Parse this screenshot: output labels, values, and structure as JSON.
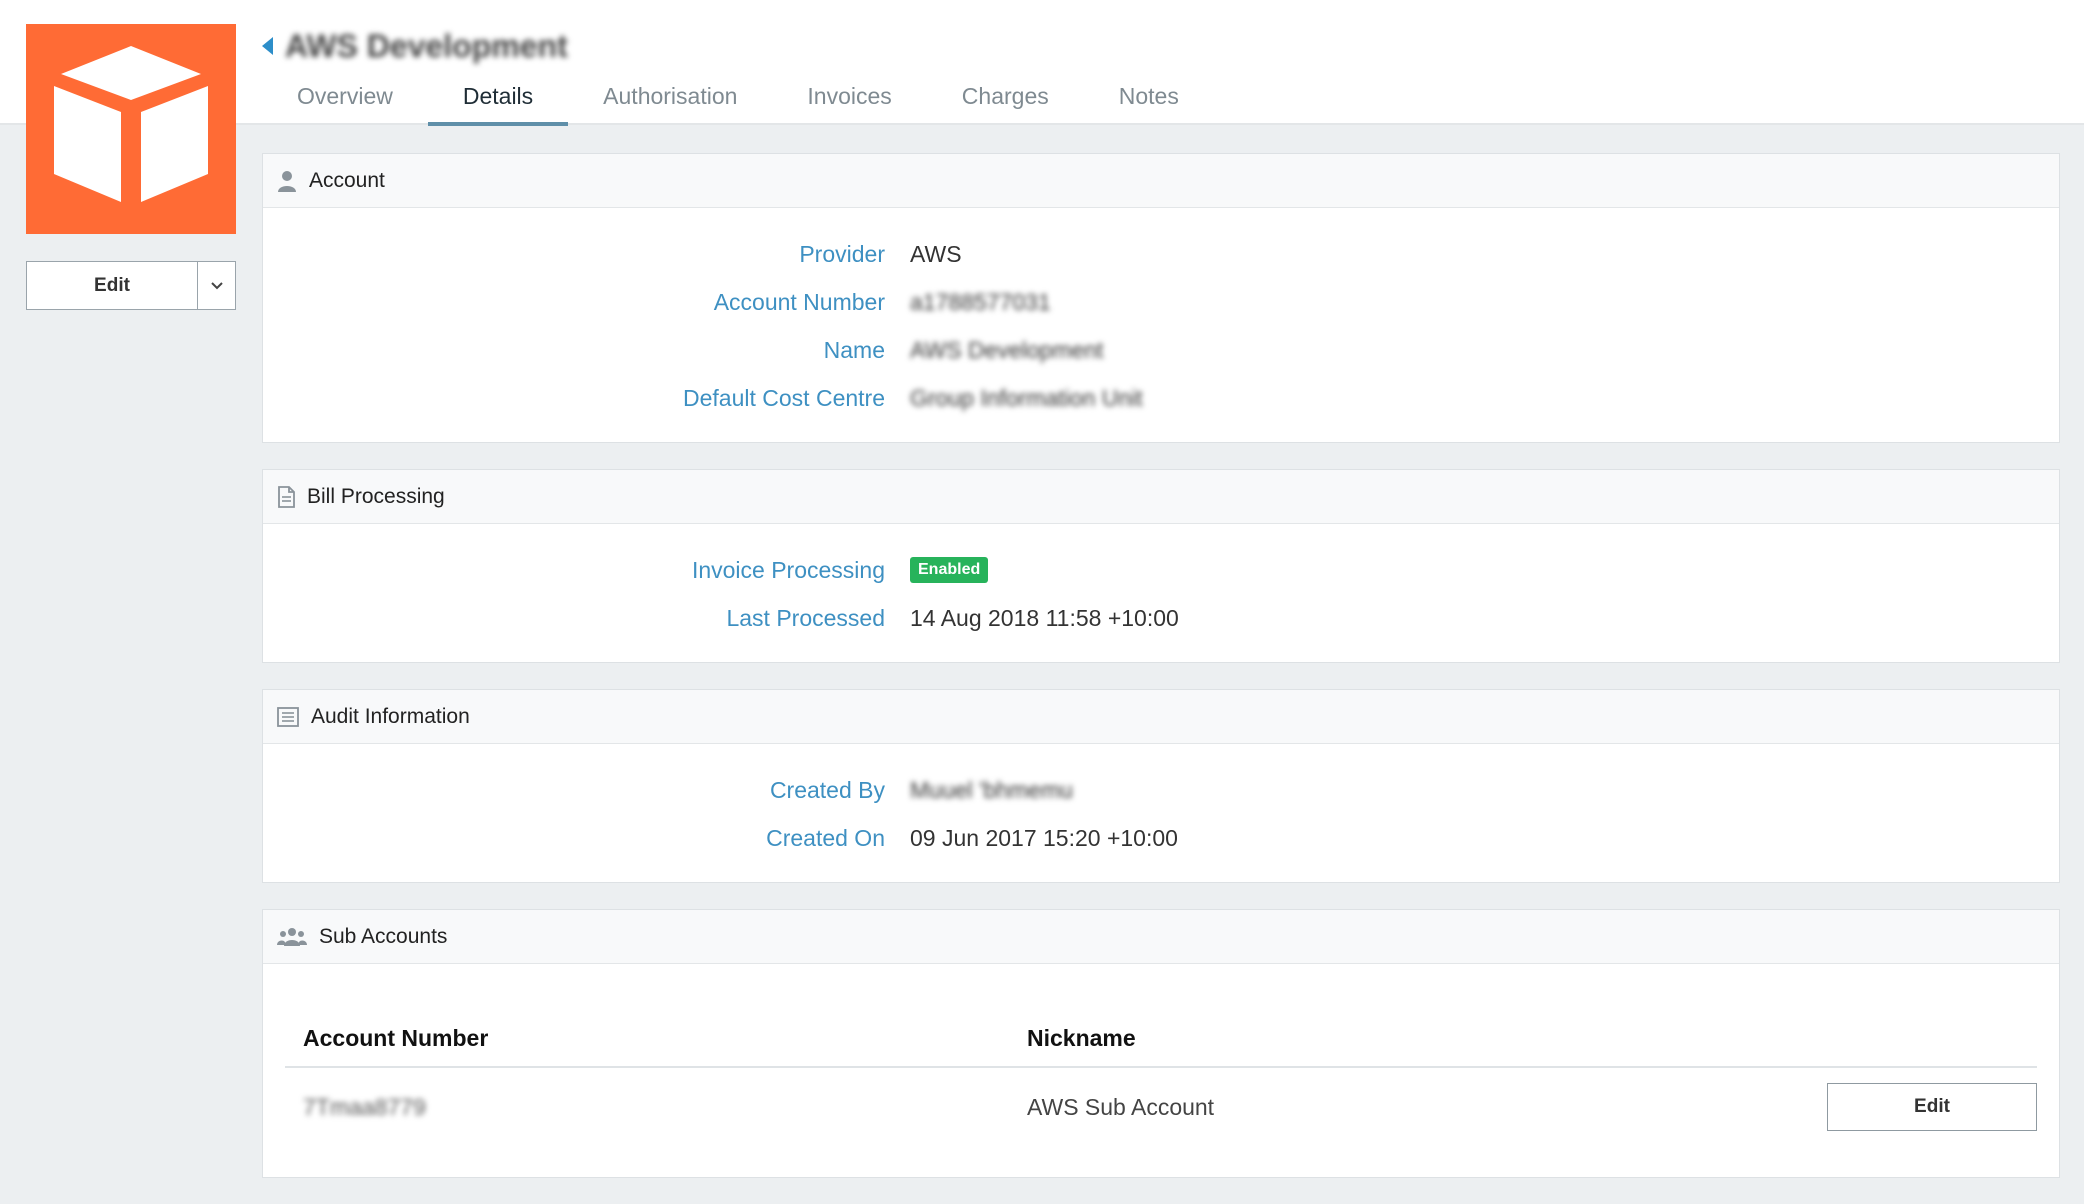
{
  "header": {
    "title": "AWS Development",
    "tabs": [
      {
        "label": "Overview"
      },
      {
        "label": "Details"
      },
      {
        "label": "Authorisation"
      },
      {
        "label": "Invoices"
      },
      {
        "label": "Charges"
      },
      {
        "label": "Notes"
      }
    ],
    "active_tab": "Details"
  },
  "sidebar": {
    "logo_icon": "cube-icon",
    "logo_color": "#ff6b35",
    "edit_label": "Edit"
  },
  "account": {
    "heading": "Account",
    "fields": [
      {
        "label": "Provider",
        "value": "AWS"
      },
      {
        "label": "Account Number",
        "value": "a1788577031"
      },
      {
        "label": "Name",
        "value": "AWS Development"
      },
      {
        "label": "Default Cost Centre",
        "value": "Group Information Unit"
      }
    ]
  },
  "bill_processing": {
    "heading": "Bill Processing",
    "invoice_processing_label": "Invoice Processing",
    "invoice_processing_status": "Enabled",
    "last_processed_label": "Last Processed",
    "last_processed_value": "14 Aug 2018 11:58 +10:00"
  },
  "audit": {
    "heading": "Audit Information",
    "created_by_label": "Created By",
    "created_by_value": "Muuel 'bhmemu",
    "created_on_label": "Created On",
    "created_on_value": "09 Jun 2017 15:20 +10:00"
  },
  "sub_accounts": {
    "heading": "Sub Accounts",
    "columns": [
      "Account Number",
      "Nickname"
    ],
    "rows": [
      {
        "account_number": "7Tmaa8779",
        "nickname": "AWS Sub Account",
        "action": "Edit"
      }
    ]
  },
  "colors": {
    "accent": "#3e90c2",
    "status_enabled": "#27b35b",
    "active_tab_underline": "#5f8fa9"
  }
}
